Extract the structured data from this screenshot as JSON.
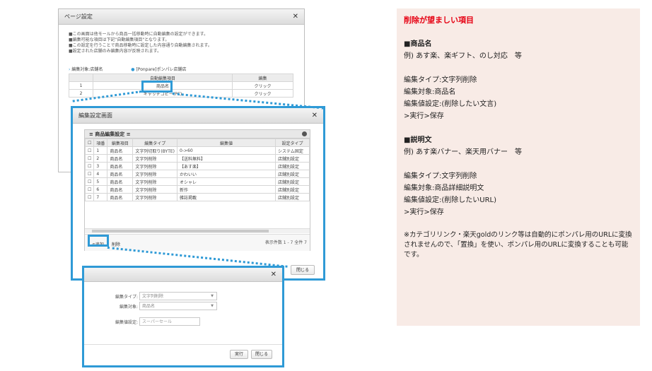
{
  "page_settings": {
    "title": "ページ設定",
    "info_lines": [
      "■この画面は他モールから商品一括移動時に自動編集の設定ができます。",
      "■編集可能な項目は下記\"自動編集項目\"となります。",
      "■この設定を行うことで商品移動時に設定した内容通り自動編集されます。",
      "■設定された店舗のみ編集内容が反映されます。"
    ],
    "target_label": "編集対象:店舗名",
    "store_option": "[Ponpare]ポンパレ店舗店",
    "table": {
      "headers": [
        "",
        "自動編集項目",
        "編集"
      ],
      "rows": [
        [
          "1",
          "商品名",
          "クリック"
        ],
        [
          "2",
          "キャッチコピー(PC)",
          "クリック"
        ]
      ]
    }
  },
  "edit_settings": {
    "title": "編集設定画面",
    "panel_title": "≡ 商品編集設定 ≡",
    "headers": [
      "",
      "項番",
      "編集項目",
      "編集タイプ",
      "編集値",
      "設定タイプ"
    ],
    "rows": [
      [
        "1",
        "商品名",
        "文字列切取り(BYTE)",
        "0->60",
        "システム固定"
      ],
      [
        "2",
        "商品名",
        "文字列削除",
        "【送料無料】",
        "店舗別設定"
      ],
      [
        "3",
        "商品名",
        "文字列削除",
        "【あす楽】",
        "店舗別設定"
      ],
      [
        "4",
        "商品名",
        "文字列削除",
        "かわいい",
        "店舗別設定"
      ],
      [
        "5",
        "商品名",
        "文字列削除",
        "オシャレ",
        "店舗別設定"
      ],
      [
        "6",
        "商品名",
        "文字列削除",
        "新作",
        "店舗別設定"
      ],
      [
        "7",
        "商品名",
        "文字列削除",
        "雑誌掲載",
        "店舗別設定"
      ]
    ],
    "add_label": "追加",
    "delete_label": "削除",
    "count_text": "表示件数 1 - 7 全件 7",
    "close_label": "閉じる"
  },
  "add_dialog": {
    "type_label": "編集タイプ:",
    "type_value": "文字列削除",
    "target_label": "編集対象:",
    "target_value": "商品名",
    "value_label": "編集値設定:",
    "value_placeholder": "スーパーセール",
    "run_label": "実行",
    "close_label": "閉じる"
  },
  "note": {
    "title": "削除が望ましい項目",
    "section1_heading": "■商品名",
    "section1_example": "例) あす楽、楽ギフト、のし対応　等",
    "section1_lines": [
      "編集タイプ:文字列削除",
      "編集対象:商品名",
      "編集値設定:(削除したい文言)",
      ">実行>保存"
    ],
    "section2_heading": "■説明文",
    "section2_example": "例) あす楽バナー、楽天用バナー　等",
    "section2_lines": [
      "編集タイプ:文字列削除",
      "編集対象:商品詳細説明文",
      "編集値設定:(削除したいURL)",
      ">実行>保存"
    ],
    "footnote": "※カテゴリリンク・楽天goldのリンク等は自動的にポンパレ用のURLに変換されませんので、「置換」を使い、ポンパレ用のURLに変換することも可能です。"
  },
  "colors": {
    "accent": "#2f9ad6",
    "note_bg": "#f8ebe6",
    "note_title": "#e60012"
  }
}
